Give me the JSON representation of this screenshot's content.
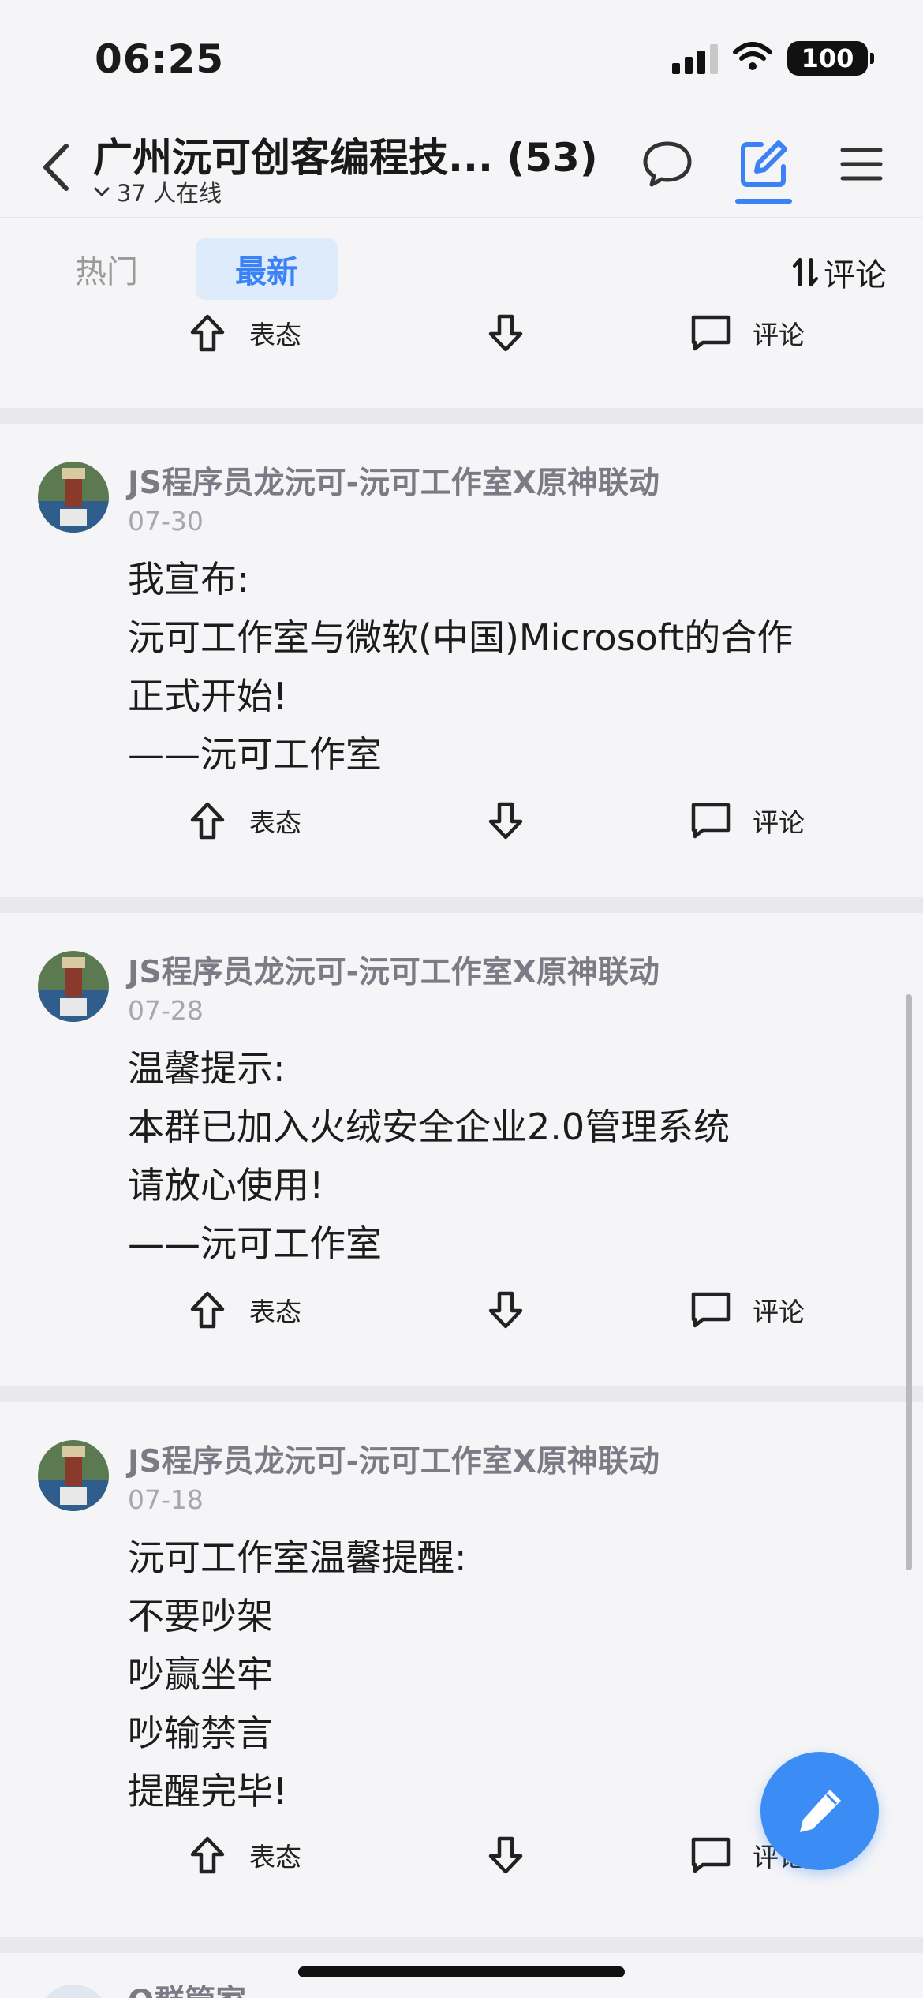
{
  "status_bar": {
    "time": "06:25",
    "battery": "100"
  },
  "header": {
    "title": "广州沅可创客编程技... (53)",
    "online": "37 人在线"
  },
  "tabs": {
    "hot": "热门",
    "latest": "最新",
    "sort_label": "评论",
    "active": "最新"
  },
  "actions": {
    "upvote": "表态",
    "comment": "评论"
  },
  "posts": [
    {
      "author": "JS程序员龙沅可-沅可工作室X原神联动",
      "date": "07-30",
      "lines": [
        "我宣布:",
        "沅可工作室与微软(中国)Microsoft的合作",
        "正式开始!",
        "——沅可工作室"
      ]
    },
    {
      "author": "JS程序员龙沅可-沅可工作室X原神联动",
      "date": "07-28",
      "lines": [
        "温馨提示:",
        "本群已加入火绒安全企业2.0管理系统",
        "请放心使用!",
        "——沅可工作室"
      ]
    },
    {
      "author": "JS程序员龙沅可-沅可工作室X原神联动",
      "date": "07-18",
      "lines": [
        "沅可工作室温馨提醒:",
        "不要吵架",
        "吵赢坐牢",
        "吵输禁言",
        "提醒完毕!"
      ]
    }
  ],
  "partial_post": {
    "author": "Q群管家"
  },
  "colors": {
    "accent": "#3b82f6",
    "fab": "#3b8cf5",
    "background": "#f5f5f7"
  }
}
